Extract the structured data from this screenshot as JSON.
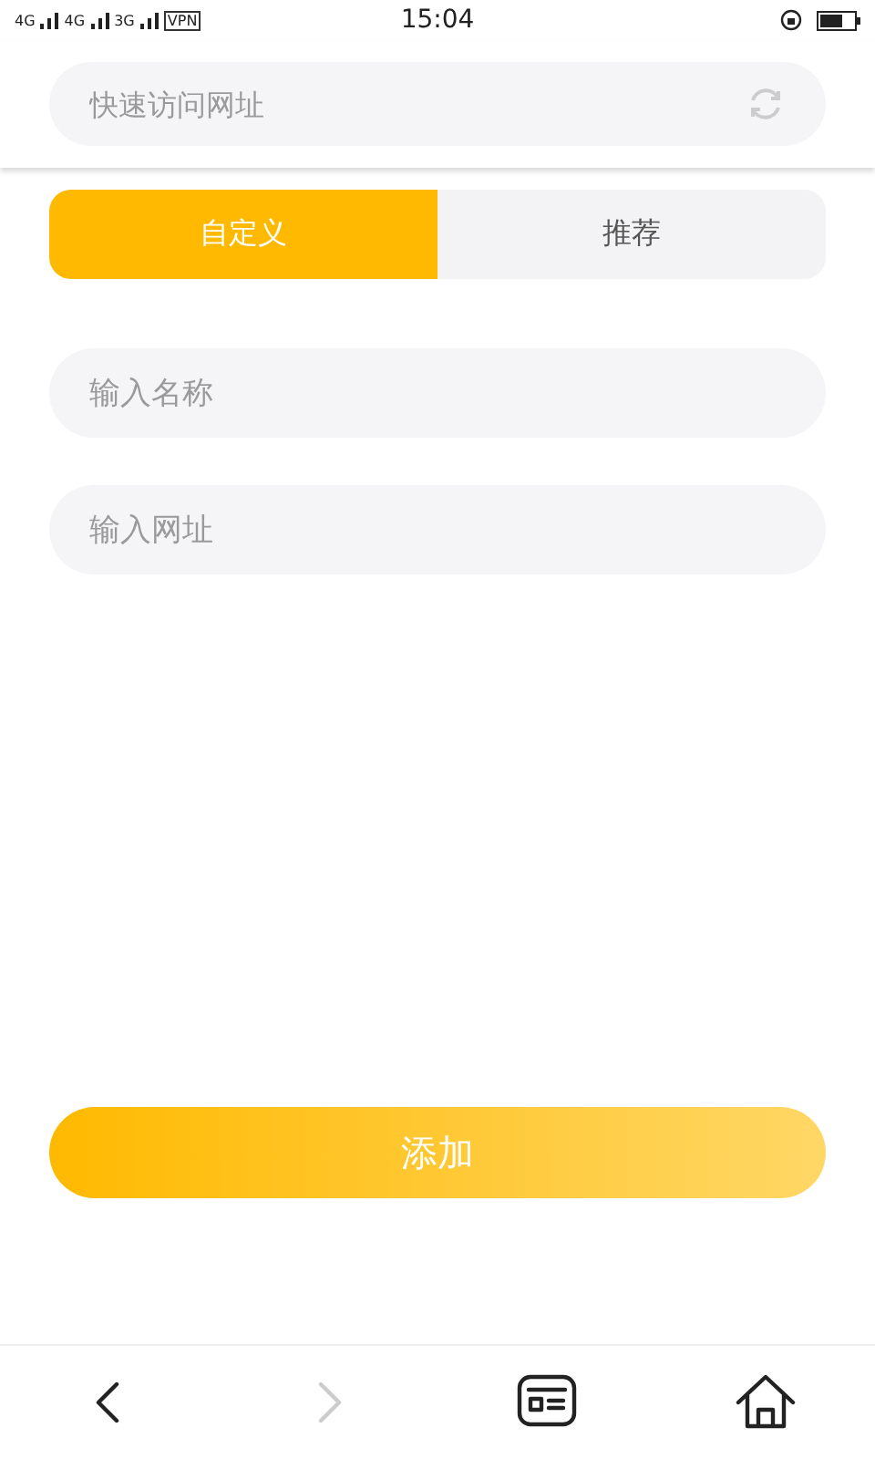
{
  "status_bar": {
    "networks": [
      "4G",
      "4G",
      "3G"
    ],
    "vpn": "VPN",
    "time": "15:04"
  },
  "search": {
    "placeholder": "快速访问网址"
  },
  "tabs": [
    {
      "label": "自定义",
      "selected": true
    },
    {
      "label": "推荐",
      "selected": false
    }
  ],
  "fields": [
    {
      "placeholder": "输入名称"
    },
    {
      "placeholder": "输入网址"
    }
  ],
  "add_button": "添加",
  "nav": [
    {
      "kind": "back",
      "disabled": false
    },
    {
      "kind": "forward",
      "disabled": true
    },
    {
      "kind": "tabs",
      "disabled": false
    },
    {
      "kind": "home",
      "disabled": false
    }
  ]
}
